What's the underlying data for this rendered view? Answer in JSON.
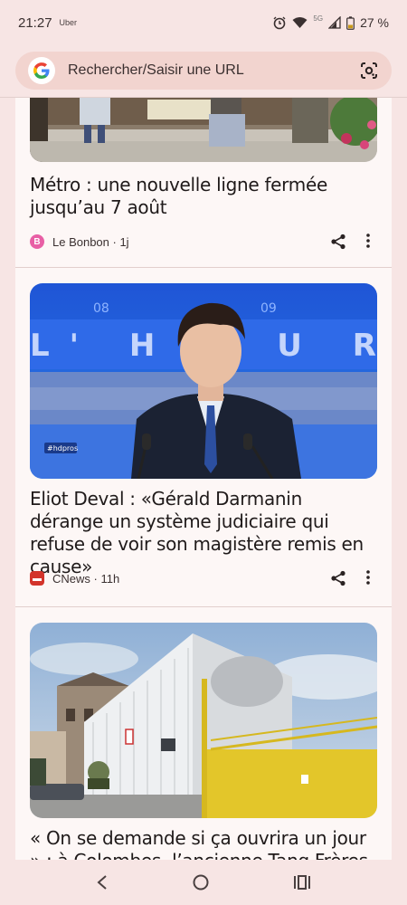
{
  "status": {
    "time": "21:27",
    "carrier": "Uber",
    "network": "5G",
    "battery": "27 %"
  },
  "search": {
    "placeholder": "Rechercher/Saisir une URL"
  },
  "articles": [
    {
      "headline": "Métro : une nouvelle ligne fermée jusqu’au 7 août",
      "source": "Le Bonbon · 1j",
      "source_color": "#e85fa5"
    },
    {
      "headline": "Eliot Deval : «Gérald Darmanin dérange un système judiciaire qui refuse de voir son magistère remis en cause»",
      "source": "CNews · 11h",
      "source_color": "#d3342b",
      "image_tag": "#hdpros",
      "studio_letters": "L' H E U R E",
      "studio_numbers": [
        "08",
        "09"
      ]
    },
    {
      "headline": "« On se demande si ça ouvrira un jour » : à Colombes, l’ancienne Tang Frères se",
      "source": "",
      "source_color": "#999999"
    }
  ],
  "icons": {
    "share": "share-icon",
    "more": "more-vert-icon",
    "lens": "camera-search-icon",
    "back": "back-icon",
    "home": "home-icon",
    "recents": "recents-icon"
  }
}
